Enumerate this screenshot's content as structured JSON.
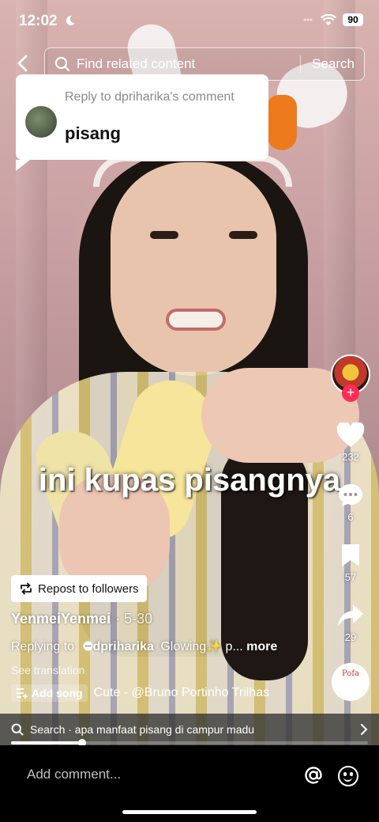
{
  "status_bar": {
    "time": "12:02",
    "battery": "90"
  },
  "search": {
    "placeholder": "Find related content",
    "button": "Search"
  },
  "reply_card": {
    "label": "Reply to dpriharika's comment",
    "comment": "pisang"
  },
  "video_caption": "ini kupas pisangnya",
  "side_actions": {
    "likes": "232",
    "comments": "6",
    "saves": "57",
    "shares": "29"
  },
  "music_disc_label": "Pofa",
  "repost_label": "Repost to followers",
  "author": {
    "name": "YenmeiYenmei",
    "date": "· 5-30"
  },
  "description": {
    "prefix": "Replying to",
    "mention": "dpriharika",
    "text": "Glowing✨ p...",
    "more": "more"
  },
  "see_translation": "See translation",
  "song": {
    "add_label": "Add song",
    "title": "Cute - @Bruno Portinho Trilhas"
  },
  "search_suggestion": "Search · apa manfaat pisang di campur madu",
  "progress": 0.2,
  "comment_placeholder": "Add comment...",
  "colors": {
    "follow_accent": "#fe2c55"
  }
}
